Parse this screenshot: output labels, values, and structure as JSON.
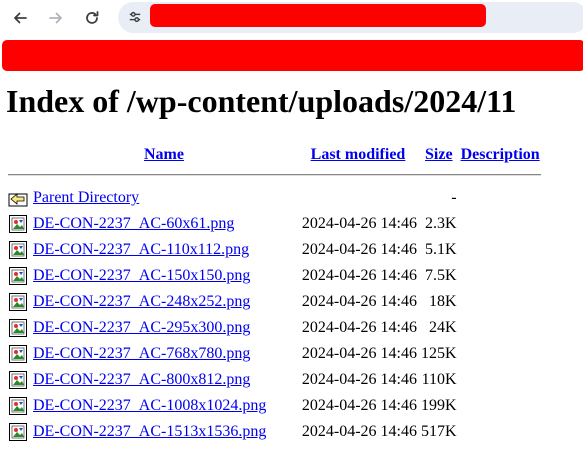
{
  "browser": {
    "back_icon": "arrow-left-icon",
    "forward_icon": "arrow-right-icon",
    "reload_icon": "reload-icon",
    "site_info_icon": "tune-icon",
    "redaction_color": "#ff0000"
  },
  "page": {
    "title": "Index of /wp-content/uploads/2024/11"
  },
  "table": {
    "headers": {
      "name": "Name",
      "last_modified": "Last modified",
      "size": "Size",
      "description": "Description"
    },
    "parent": {
      "name": "Parent Directory",
      "size": "-",
      "icon": "back-folder-icon"
    },
    "rows": [
      {
        "name": "DE-CON-2237_AC-60x61.png",
        "modified": "2024-04-26 14:46",
        "size": "2.3K"
      },
      {
        "name": "DE-CON-2237_AC-110x112.png",
        "modified": "2024-04-26 14:46",
        "size": "5.1K"
      },
      {
        "name": "DE-CON-2237_AC-150x150.png",
        "modified": "2024-04-26 14:46",
        "size": "7.5K"
      },
      {
        "name": "DE-CON-2237_AC-248x252.png",
        "modified": "2024-04-26 14:46",
        "size": "18K"
      },
      {
        "name": "DE-CON-2237_AC-295x300.png",
        "modified": "2024-04-26 14:46",
        "size": "24K"
      },
      {
        "name": "DE-CON-2237_AC-768x780.png",
        "modified": "2024-04-26 14:46",
        "size": "125K"
      },
      {
        "name": "DE-CON-2237_AC-800x812.png",
        "modified": "2024-04-26 14:46",
        "size": "110K"
      },
      {
        "name": "DE-CON-2237_AC-1008x1024.png",
        "modified": "2024-04-26 14:46",
        "size": "199K"
      },
      {
        "name": "DE-CON-2237_AC-1513x1536.png",
        "modified": "2024-04-26 14:46",
        "size": "517K"
      }
    ]
  }
}
